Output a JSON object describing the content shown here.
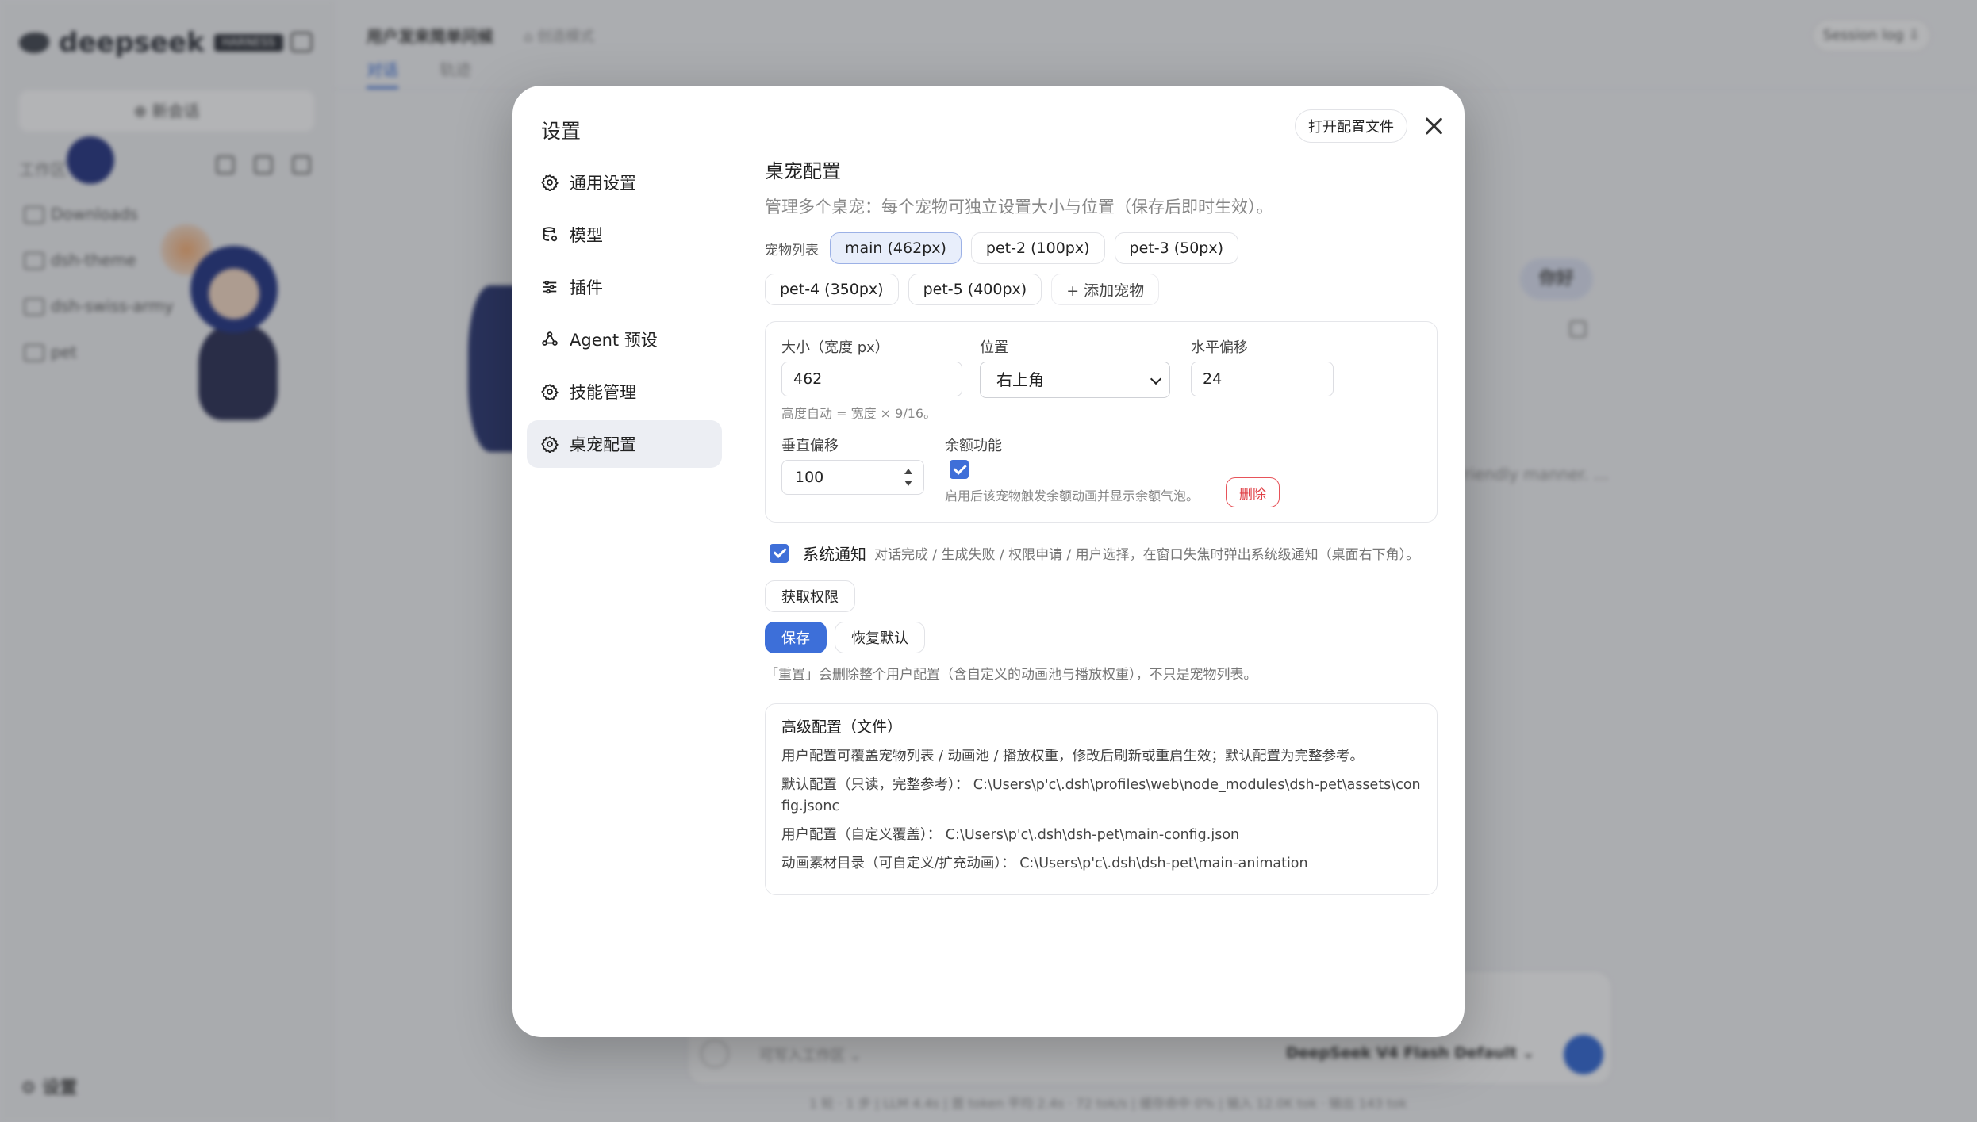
{
  "background": {
    "logo_text": "deepseek",
    "logo_badge": "HARNESS",
    "new_chat": "⊕ 新会话",
    "workspace_label": "工作区",
    "tree": [
      "Downloads",
      "dsh-theme",
      "dsh-swiss-army",
      "pet"
    ],
    "settings": "⚙ 设置",
    "header_title": "用户发来简单问候",
    "header_mode": "⌂ 创造模式",
    "tabs": [
      "对话",
      "轨迹"
    ],
    "session_log": "Session log ⇩",
    "user_bubble": "你好",
    "reply_snippet": "friendly manner. ...",
    "composer_workspace": "可写入工作区 ⌄",
    "composer_model": "DeepSeek V4 Flash Default ⌄",
    "status_bar": "1 轮 · 1 步 | LLM 4.4s | 首 token 平均 2.4s · 72 tok/s | 缓存命中 0% | 输入 12.0K tok · 输出 143 tok"
  },
  "modal": {
    "title": "设置",
    "open_config_label": "打开配置文件",
    "nav": [
      {
        "label": "通用设置",
        "icon": "gear-icon"
      },
      {
        "label": "模型",
        "icon": "database-icon"
      },
      {
        "label": "插件",
        "icon": "sliders-icon"
      },
      {
        "label": "Agent 预设",
        "icon": "agent-icon"
      },
      {
        "label": "技能管理",
        "icon": "gear-icon"
      },
      {
        "label": "桌宠配置",
        "icon": "gear-icon",
        "active": true
      }
    ],
    "section": {
      "title": "桌宠配置",
      "description": "管理多个桌宠：每个宠物可独立设置大小与位置（保存后即时生效）。",
      "pet_list_label": "宠物列表",
      "pets": [
        "main (462px)",
        "pet-2 (100px)",
        "pet-3 (50px)",
        "pet-4 (350px)",
        "pet-5 (400px)"
      ],
      "add_pet_label": "+ 添加宠物",
      "size_label": "大小（宽度 px）",
      "size_value": "462",
      "size_hint": "高度自动 = 宽度 × 9/16。",
      "position_label": "位置",
      "position_value": "右上角",
      "h_offset_label": "水平偏移",
      "h_offset_value": "24",
      "v_offset_label": "垂直偏移",
      "v_offset_value": "100",
      "quota_label": "余额功能",
      "quota_hint": "启用后该宠物触发余额动画并显示余额气泡。",
      "delete_label": "删除",
      "notify_label": "系统通知",
      "notify_desc": "对话完成 / 生成失败 / 权限申请 / 用户选择，在窗口失焦时弹出系统级通知（桌面右下角）。",
      "permission_label": "获取权限",
      "save_label": "保存",
      "restore_label": "恢复默认",
      "reset_note": "「重置」会删除整个用户配置（含自定义的动画池与播放权重），不只是宠物列表。",
      "advanced": {
        "title": "高级配置（文件）",
        "line1": "用户配置可覆盖宠物列表 / 动画池 / 播放权重，修改后刷新或重启生效；默认配置为完整参考。",
        "line2": "默认配置（只读，完整参考）： C:\\Users\\p'c\\.dsh\\profiles\\web\\node_modules\\dsh-pet\\assets\\config.jsonc",
        "line3": "用户配置（自定义覆盖）： C:\\Users\\p'c\\.dsh\\dsh-pet\\main-config.json",
        "line4": "动画素材目录（可自定义/扩充动画）： C:\\Users\\p'c\\.dsh\\dsh-pet\\main-animation"
      }
    }
  },
  "colors": {
    "accent": "#3d6fd9",
    "danger": "#e04046"
  }
}
